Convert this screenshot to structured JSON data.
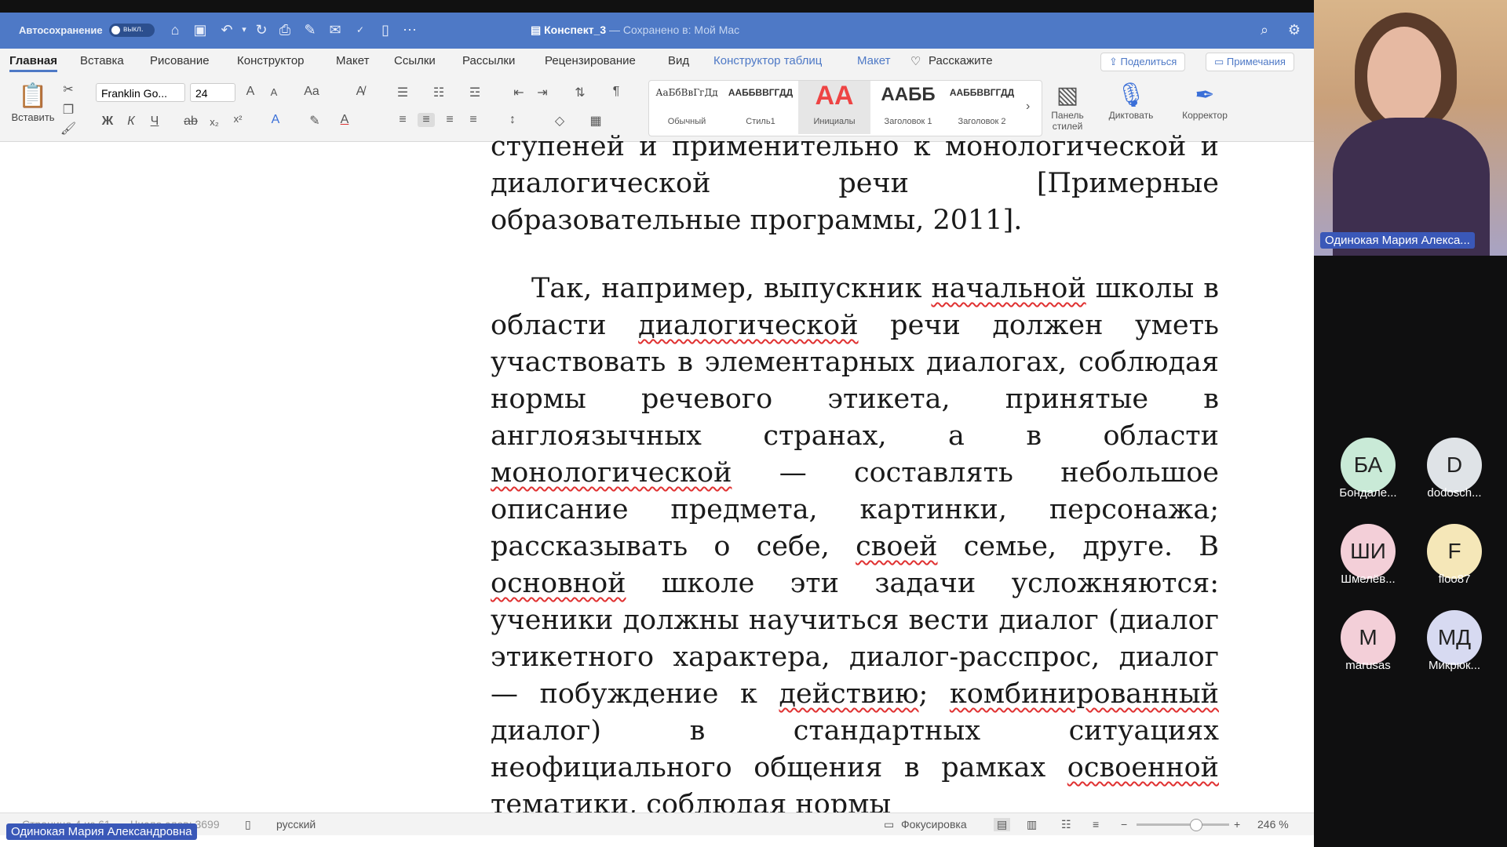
{
  "title_bar": {
    "autosave_label": "Автосохранение",
    "autosave_state": "выкл.",
    "doc_name": "Конспект_3",
    "doc_status": "— Сохранено в: Мой Mac"
  },
  "ribbon_tabs": [
    "Главная",
    "Вставка",
    "Рисование",
    "Конструктор",
    "Макет",
    "Ссылки",
    "Рассылки",
    "Рецензирование",
    "Вид",
    "Конструктор таблиц",
    "Макет"
  ],
  "tell_me": "Расскажите",
  "share_label": "Поделиться",
  "comments_label": "Примечания",
  "ribbon": {
    "paste_label": "Вставить",
    "font_name": "Franklin Go...",
    "font_size": "24",
    "bold": "Ж",
    "italic": "К",
    "underline": "Ч",
    "styles": [
      {
        "preview": "АаБбВвГгДд",
        "name": "Обычный"
      },
      {
        "preview": "ААББВВГГДД",
        "name": "Стиль1"
      },
      {
        "preview": "АА",
        "name": "Инициалы"
      },
      {
        "preview": "ААББ",
        "name": "Заголовок 1"
      },
      {
        "preview": "ААББВВГГДД",
        "name": "Заголовок 2"
      }
    ],
    "styles_pane": "Панель стилей",
    "dictate": "Диктовать",
    "editor": "Корректор"
  },
  "document": {
    "para1": "ступеней и применительно к монологической и диалогической речи [Примерные образовательные программы, 2011].",
    "para2_a": "Так, например, выпускник ",
    "para2_b": "начальной",
    "para2_c": " школы в области ",
    "para2_d": "диалогической",
    "para2_e": " речи должен уметь участвовать в элементарных диалогах, соблюдая нормы речевого этикета, принятые в англоязычных странах, а в области ",
    "para2_f": "монологической",
    "para2_g": " — составлять небольшое описание предмета, картинки, персонажа; рассказывать о себе, ",
    "para2_h": "своей",
    "para2_i": " семье, друге. В ",
    "para2_j": "основной",
    "para2_k": " школе эти задачи усложняются: ученики должны научиться вести диалог (диалог этикетного характера, диалог-расспрос, диалог — побуждение к ",
    "para2_l": "действию",
    "para2_m": "; ",
    "para2_n": "комбинированный",
    "para2_o": " диалог) в стандартных ситуациях неофициального общения в рамках ",
    "para2_p": "освоенной",
    "para2_q": " тематики, соблюдая нормы"
  },
  "status_bar": {
    "page": "Страница 4 из 61",
    "words": "Число слов: 3699",
    "language": "русский",
    "focus": "Фокусировка",
    "zoom": "246 %"
  },
  "speaker": {
    "name_tile": "Одинокая Мария Алекса...",
    "name_bottom": "Одинокая Мария Александровна"
  },
  "participants": [
    {
      "initials": "БА",
      "name": "Бондале...",
      "color": "#c9ead7"
    },
    {
      "initials": "D",
      "name": "dodosch...",
      "color": "#dfe3e7"
    },
    {
      "initials": "ШИ",
      "name": "Шмелёв...",
      "color": "#f3cfd8"
    },
    {
      "initials": "F",
      "name": "floo87",
      "color": "#f5e7b8"
    },
    {
      "initials": "М",
      "name": "marusas",
      "color": "#f3cfd8"
    },
    {
      "initials": "МД",
      "name": "Микрюк...",
      "color": "#d7daf1"
    }
  ]
}
